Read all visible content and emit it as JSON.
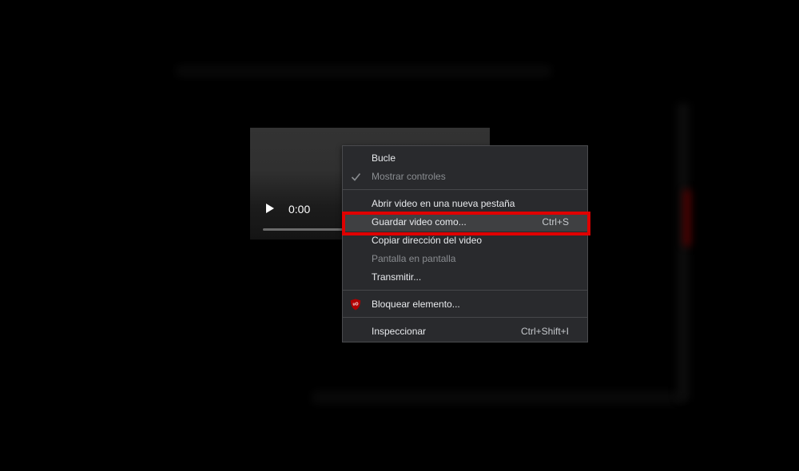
{
  "video_player": {
    "current_time": "0:00"
  },
  "context_menu": {
    "items": [
      {
        "label": "Bucle",
        "shortcut": "",
        "checked": false,
        "disabled": false,
        "icon": ""
      },
      {
        "label": "Mostrar controles",
        "shortcut": "",
        "checked": true,
        "disabled": true,
        "icon": "check-icon"
      },
      {
        "label": "Abrir video en una nueva pestaña",
        "shortcut": "",
        "checked": false,
        "disabled": false,
        "icon": ""
      },
      {
        "label": "Guardar video como...",
        "shortcut": "Ctrl+S",
        "checked": false,
        "disabled": false,
        "icon": ""
      },
      {
        "label": "Copiar dirección del video",
        "shortcut": "",
        "checked": false,
        "disabled": false,
        "icon": ""
      },
      {
        "label": "Pantalla en pantalla",
        "shortcut": "",
        "checked": false,
        "disabled": true,
        "icon": ""
      },
      {
        "label": "Transmitir...",
        "shortcut": "",
        "checked": false,
        "disabled": false,
        "icon": ""
      },
      {
        "label": "Bloquear elemento...",
        "shortcut": "",
        "checked": false,
        "disabled": false,
        "icon": "ublock-origin-icon"
      },
      {
        "label": "Inspeccionar",
        "shortcut": "Ctrl+Shift+I",
        "checked": false,
        "disabled": false,
        "icon": ""
      }
    ],
    "highlighted_item": "Guardar video como..."
  },
  "colors": {
    "background": "#000000",
    "menu_background": "#292a2d",
    "menu_text": "#e8eaed",
    "menu_disabled_text": "#8a8d91",
    "highlight_annotation": "#e00000",
    "ublock_icon": "#b00000"
  },
  "logos": {
    "ublock": "uO"
  }
}
